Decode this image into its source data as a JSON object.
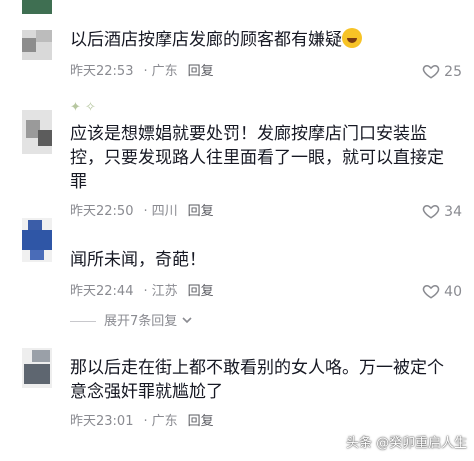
{
  "comments": [
    {
      "text": "以后酒店按摩店发廊的顾客都有嫌疑",
      "emoji": "laughing-crying-emoji",
      "time": "昨天22:53",
      "location": "广东",
      "reply": "回复",
      "likes": "25"
    },
    {
      "text": "应该是想嫖娼就要处罚！发廊按摩店门口安装监控，只要发现路人往里面看了一眼，就可以直接定罪",
      "time": "昨天22:50",
      "location": "四川",
      "reply": "回复",
      "likes": "34"
    },
    {
      "text": "闻所未闻，奇葩！",
      "time": "昨天22:44",
      "location": "江苏",
      "reply": "回复",
      "likes": "40"
    },
    {
      "text": "那以后走在街上都不敢看别的女人咯。万一被定个意念强奸罪就尴尬了",
      "time": "昨天23:01",
      "location": "广东",
      "reply": "回复"
    }
  ],
  "expand_label": "展开7条回复",
  "watermark": "头条 @癸卯重启人生",
  "colors": {
    "meta": "#8a8b91",
    "text": "#161823"
  }
}
